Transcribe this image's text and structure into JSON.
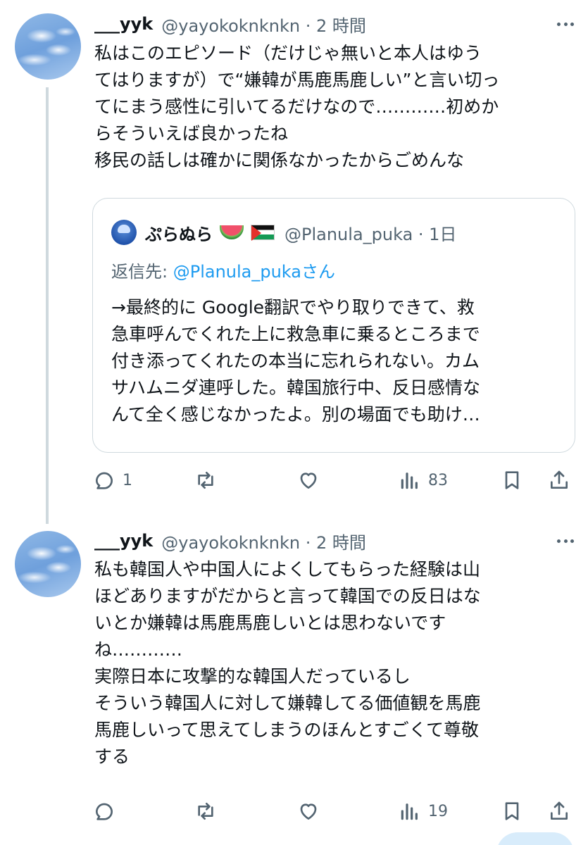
{
  "tweets": [
    {
      "display_name": "___yyk",
      "handle_time": "@yayokoknknkn · 2 時間",
      "lines": [
        "私はこのエピソード（だけじゃ無いと本人はゆう",
        "てはりますが）で“嫌韓が馬鹿馬鹿しい”と言い切っ",
        "てにまう感性に引いてるだけなので…………初めか",
        "らそういえば良かったね",
        "移民の話しは確かに関係なかったからごめんな"
      ],
      "quote": {
        "display_name": "ぷらぬら",
        "handle_time": "@Planula_puka · 1日",
        "reply_prefix": "返信先: ",
        "reply_link": "@Planula_puka",
        "reply_suffix": "さん",
        "lines": [
          "→最終的に Google翻訳でやり取りできて、救",
          "急車呼んでくれた上に救急車に乗るところまで",
          "付き添ってくれたの本当に忘れられない。カム",
          "サハムニダ連呼した。韓国旅行中、反日感情な",
          "んて全く感じなかったよ。別の場面でも助け…"
        ]
      },
      "reply_count": "1",
      "repost_count": "",
      "like_count": "",
      "view_count": "83"
    },
    {
      "display_name": "___yyk",
      "handle_time": "@yayokoknknkn · 2 時間",
      "lines": [
        "私も韓国人や中国人によくしてもらった経験は山",
        "ほどありますがだからと言って韓国での反日はな",
        "いとか嫌韓は馬鹿馬鹿しいとは思わないです",
        "ね…………",
        "実際日本に攻撃的な韓国人だっているし",
        "そういう韓国人に対して嫌韓してる価値観を馬鹿",
        "馬鹿しいって思えてしまうのほんとすごくて尊敬",
        "する"
      ],
      "reply_count": "",
      "repost_count": "",
      "like_count": "",
      "view_count": "19"
    }
  ],
  "icons": {
    "reply": "reply-icon",
    "repost": "repost-icon",
    "like": "heart-icon",
    "views": "views-icon",
    "bookmark": "bookmark-icon",
    "share": "share-icon",
    "more": "more-icon"
  },
  "colors": {
    "text": "#0f1419",
    "secondary": "#536471",
    "link": "#1d9bf0",
    "border": "#cfd9de"
  }
}
